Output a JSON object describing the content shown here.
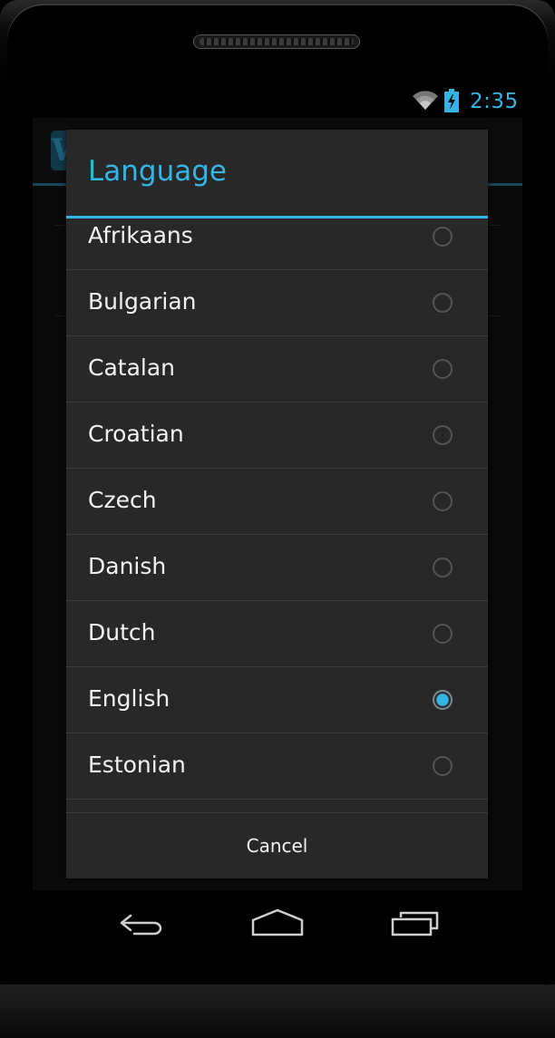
{
  "status_bar": {
    "time": "2:35",
    "clock_color": "#33b5e5",
    "icons": [
      "wifi-icon",
      "battery-charging-icon"
    ]
  },
  "background_app": {
    "logo_letter": "W"
  },
  "dialog": {
    "title": "Language",
    "accent_color": "#33b5e5",
    "items": [
      {
        "label": "Afrikaans",
        "selected": false
      },
      {
        "label": "Bulgarian",
        "selected": false
      },
      {
        "label": "Catalan",
        "selected": false
      },
      {
        "label": "Croatian",
        "selected": false
      },
      {
        "label": "Czech",
        "selected": false
      },
      {
        "label": "Danish",
        "selected": false
      },
      {
        "label": "Dutch",
        "selected": false
      },
      {
        "label": "English",
        "selected": true
      },
      {
        "label": "Estonian",
        "selected": false
      }
    ],
    "cancel_label": "Cancel"
  },
  "nav_bar": {
    "icons": [
      "back-icon",
      "home-icon",
      "recent-apps-icon"
    ]
  }
}
